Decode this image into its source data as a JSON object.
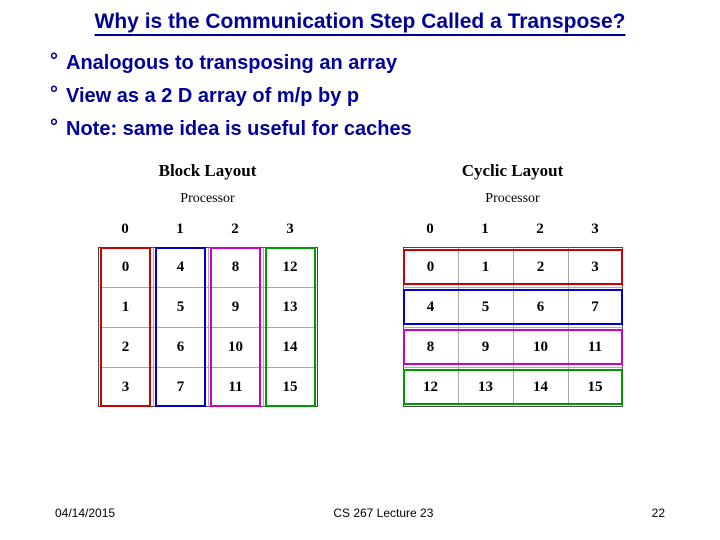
{
  "title": "Why is the Communication Step Called a Transpose?",
  "bullets": [
    "Analogous to transposing an array",
    "View as a 2 D array of m/p by p",
    "Note: same idea is useful for caches"
  ],
  "layouts": {
    "block": {
      "title": "Block Layout",
      "processor_label": "Processor",
      "headers": [
        "0",
        "1",
        "2",
        "3"
      ],
      "rows": [
        [
          "0",
          "4",
          "8",
          "12"
        ],
        [
          "1",
          "5",
          "9",
          "13"
        ],
        [
          "2",
          "6",
          "10",
          "14"
        ],
        [
          "3",
          "7",
          "11",
          "15"
        ]
      ],
      "box_colors": [
        "#cc0000",
        "#0000cc",
        "#cc00cc",
        "#009900"
      ]
    },
    "cyclic": {
      "title": "Cyclic Layout",
      "processor_label": "Processor",
      "headers": [
        "0",
        "1",
        "2",
        "3"
      ],
      "rows": [
        [
          "0",
          "1",
          "2",
          "3"
        ],
        [
          "4",
          "5",
          "6",
          "7"
        ],
        [
          "8",
          "9",
          "10",
          "11"
        ],
        [
          "12",
          "13",
          "14",
          "15"
        ]
      ],
      "box_colors": [
        "#cc0000",
        "#0000cc",
        "#cc00cc",
        "#009900"
      ]
    }
  },
  "footer": {
    "date": "04/14/2015",
    "center": "CS 267 Lecture 23",
    "page": "22"
  },
  "chart_data": {
    "type": "table",
    "title": "Block vs Cyclic Layout Transpose",
    "tables": [
      {
        "name": "Block Layout",
        "columns": [
          "Processor 0",
          "Processor 1",
          "Processor 2",
          "Processor 3"
        ],
        "data": [
          [
            0,
            4,
            8,
            12
          ],
          [
            1,
            5,
            9,
            13
          ],
          [
            2,
            6,
            10,
            14
          ],
          [
            3,
            7,
            11,
            15
          ]
        ]
      },
      {
        "name": "Cyclic Layout",
        "columns": [
          "Processor 0",
          "Processor 1",
          "Processor 2",
          "Processor 3"
        ],
        "data": [
          [
            0,
            1,
            2,
            3
          ],
          [
            4,
            5,
            6,
            7
          ],
          [
            8,
            9,
            10,
            11
          ],
          [
            12,
            13,
            14,
            15
          ]
        ]
      }
    ]
  }
}
